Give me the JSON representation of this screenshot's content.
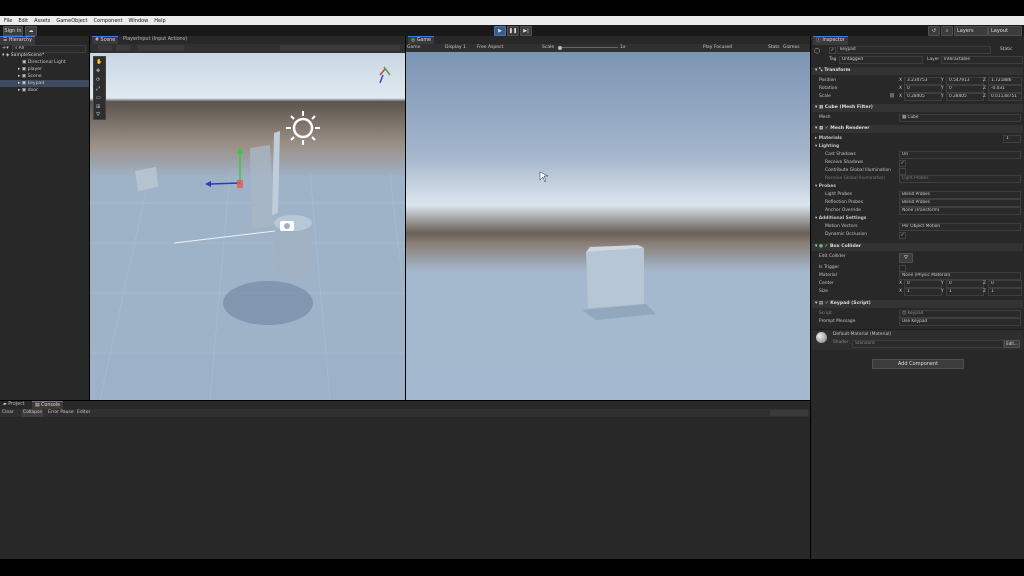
{
  "menu": [
    "File",
    "Edit",
    "Assets",
    "GameObject",
    "Component",
    "Window",
    "Help"
  ],
  "toolbar": {
    "sign_in": "Sign In",
    "layers": "Layers",
    "layout": "Layout",
    "play_icon": "play-icon",
    "pause_icon": "pause-icon",
    "step_icon": "step-icon"
  },
  "hierarchy": {
    "tab": "Hierarchy",
    "search_placeholder": "All",
    "scene": "SampleScene*",
    "items": [
      "Directional Light",
      "player",
      "Scene",
      "keypad",
      "door"
    ]
  },
  "scene_view": {
    "tabs": [
      "Scene",
      "PlayerInput (Input Actions)"
    ]
  },
  "game_view": {
    "tab": "Game",
    "display_mode": "Game",
    "display": "Display 1",
    "aspect": "Free Aspect",
    "scale_label": "Scale",
    "scale_value": "1x",
    "play_focused": "Play Focused",
    "stats": "Stats",
    "gizmos": "Gizmos"
  },
  "bottom": {
    "tabs": [
      "Project",
      "Console"
    ],
    "buttons": [
      "Clear",
      "Collapse",
      "Error Pause",
      "Editor"
    ]
  },
  "inspector": {
    "tab": "Inspector",
    "object_name": "keypad",
    "static_label": "Static",
    "tag_label": "Tag",
    "tag_value": "Untagged",
    "layer_label": "Layer",
    "layer_value": "Interactable",
    "transform": {
      "title": "Transform",
      "position_label": "Position",
      "rotation_label": "Rotation",
      "scale_label": "Scale",
      "position": [
        "3.234753",
        "0.547913",
        "1.721886"
      ],
      "rotation": [
        "0",
        "0",
        "-0.031"
      ],
      "scale": [
        "0.28405",
        "0.28405",
        "0.01138751"
      ]
    },
    "mesh_filter": {
      "title": "Cube (Mesh Filter)",
      "mesh_label": "Mesh",
      "mesh_value": "Cube"
    },
    "mesh_renderer": {
      "title": "Mesh Renderer",
      "materials": "Materials",
      "materials_count": "1",
      "lighting": "Lighting",
      "cast_shadows_label": "Cast Shadows",
      "cast_shadows": "On",
      "receive_shadows": "Receive Shadows",
      "contribute_gi": "Contribute Global Illumination",
      "receive_gi_label": "Receive Global Illumination",
      "receive_gi": "Light Probes",
      "probes": "Probes",
      "light_probes_label": "Light Probes",
      "light_probes": "Blend Probes",
      "reflection_probes_label": "Reflection Probes",
      "reflection_probes": "Blend Probes",
      "anchor_override_label": "Anchor Override",
      "anchor_override": "None (Transform)",
      "additional": "Additional Settings",
      "motion_vectors_label": "Motion Vectors",
      "motion_vectors": "Per Object Motion",
      "dynamic_occlusion": "Dynamic Occlusion"
    },
    "box_collider": {
      "title": "Box Collider",
      "edit_collider": "Edit Collider",
      "is_trigger": "Is Trigger",
      "material_label": "Material",
      "material": "None (Physic Material)",
      "center_label": "Center",
      "center": [
        "0",
        "0",
        "0"
      ],
      "size_label": "Size",
      "size": [
        "1",
        "1",
        "1"
      ]
    },
    "keypad_script": {
      "title": "Keypad (Script)",
      "script_label": "Script",
      "script_value": "Keypad",
      "prompt_label": "Prompt Message",
      "prompt_value": "Use Keypad"
    },
    "material": {
      "name": "Default-Material (Material)",
      "shader_label": "Shader",
      "shader": "Standard",
      "edit": "Edit..."
    },
    "add_component": "Add Component"
  }
}
